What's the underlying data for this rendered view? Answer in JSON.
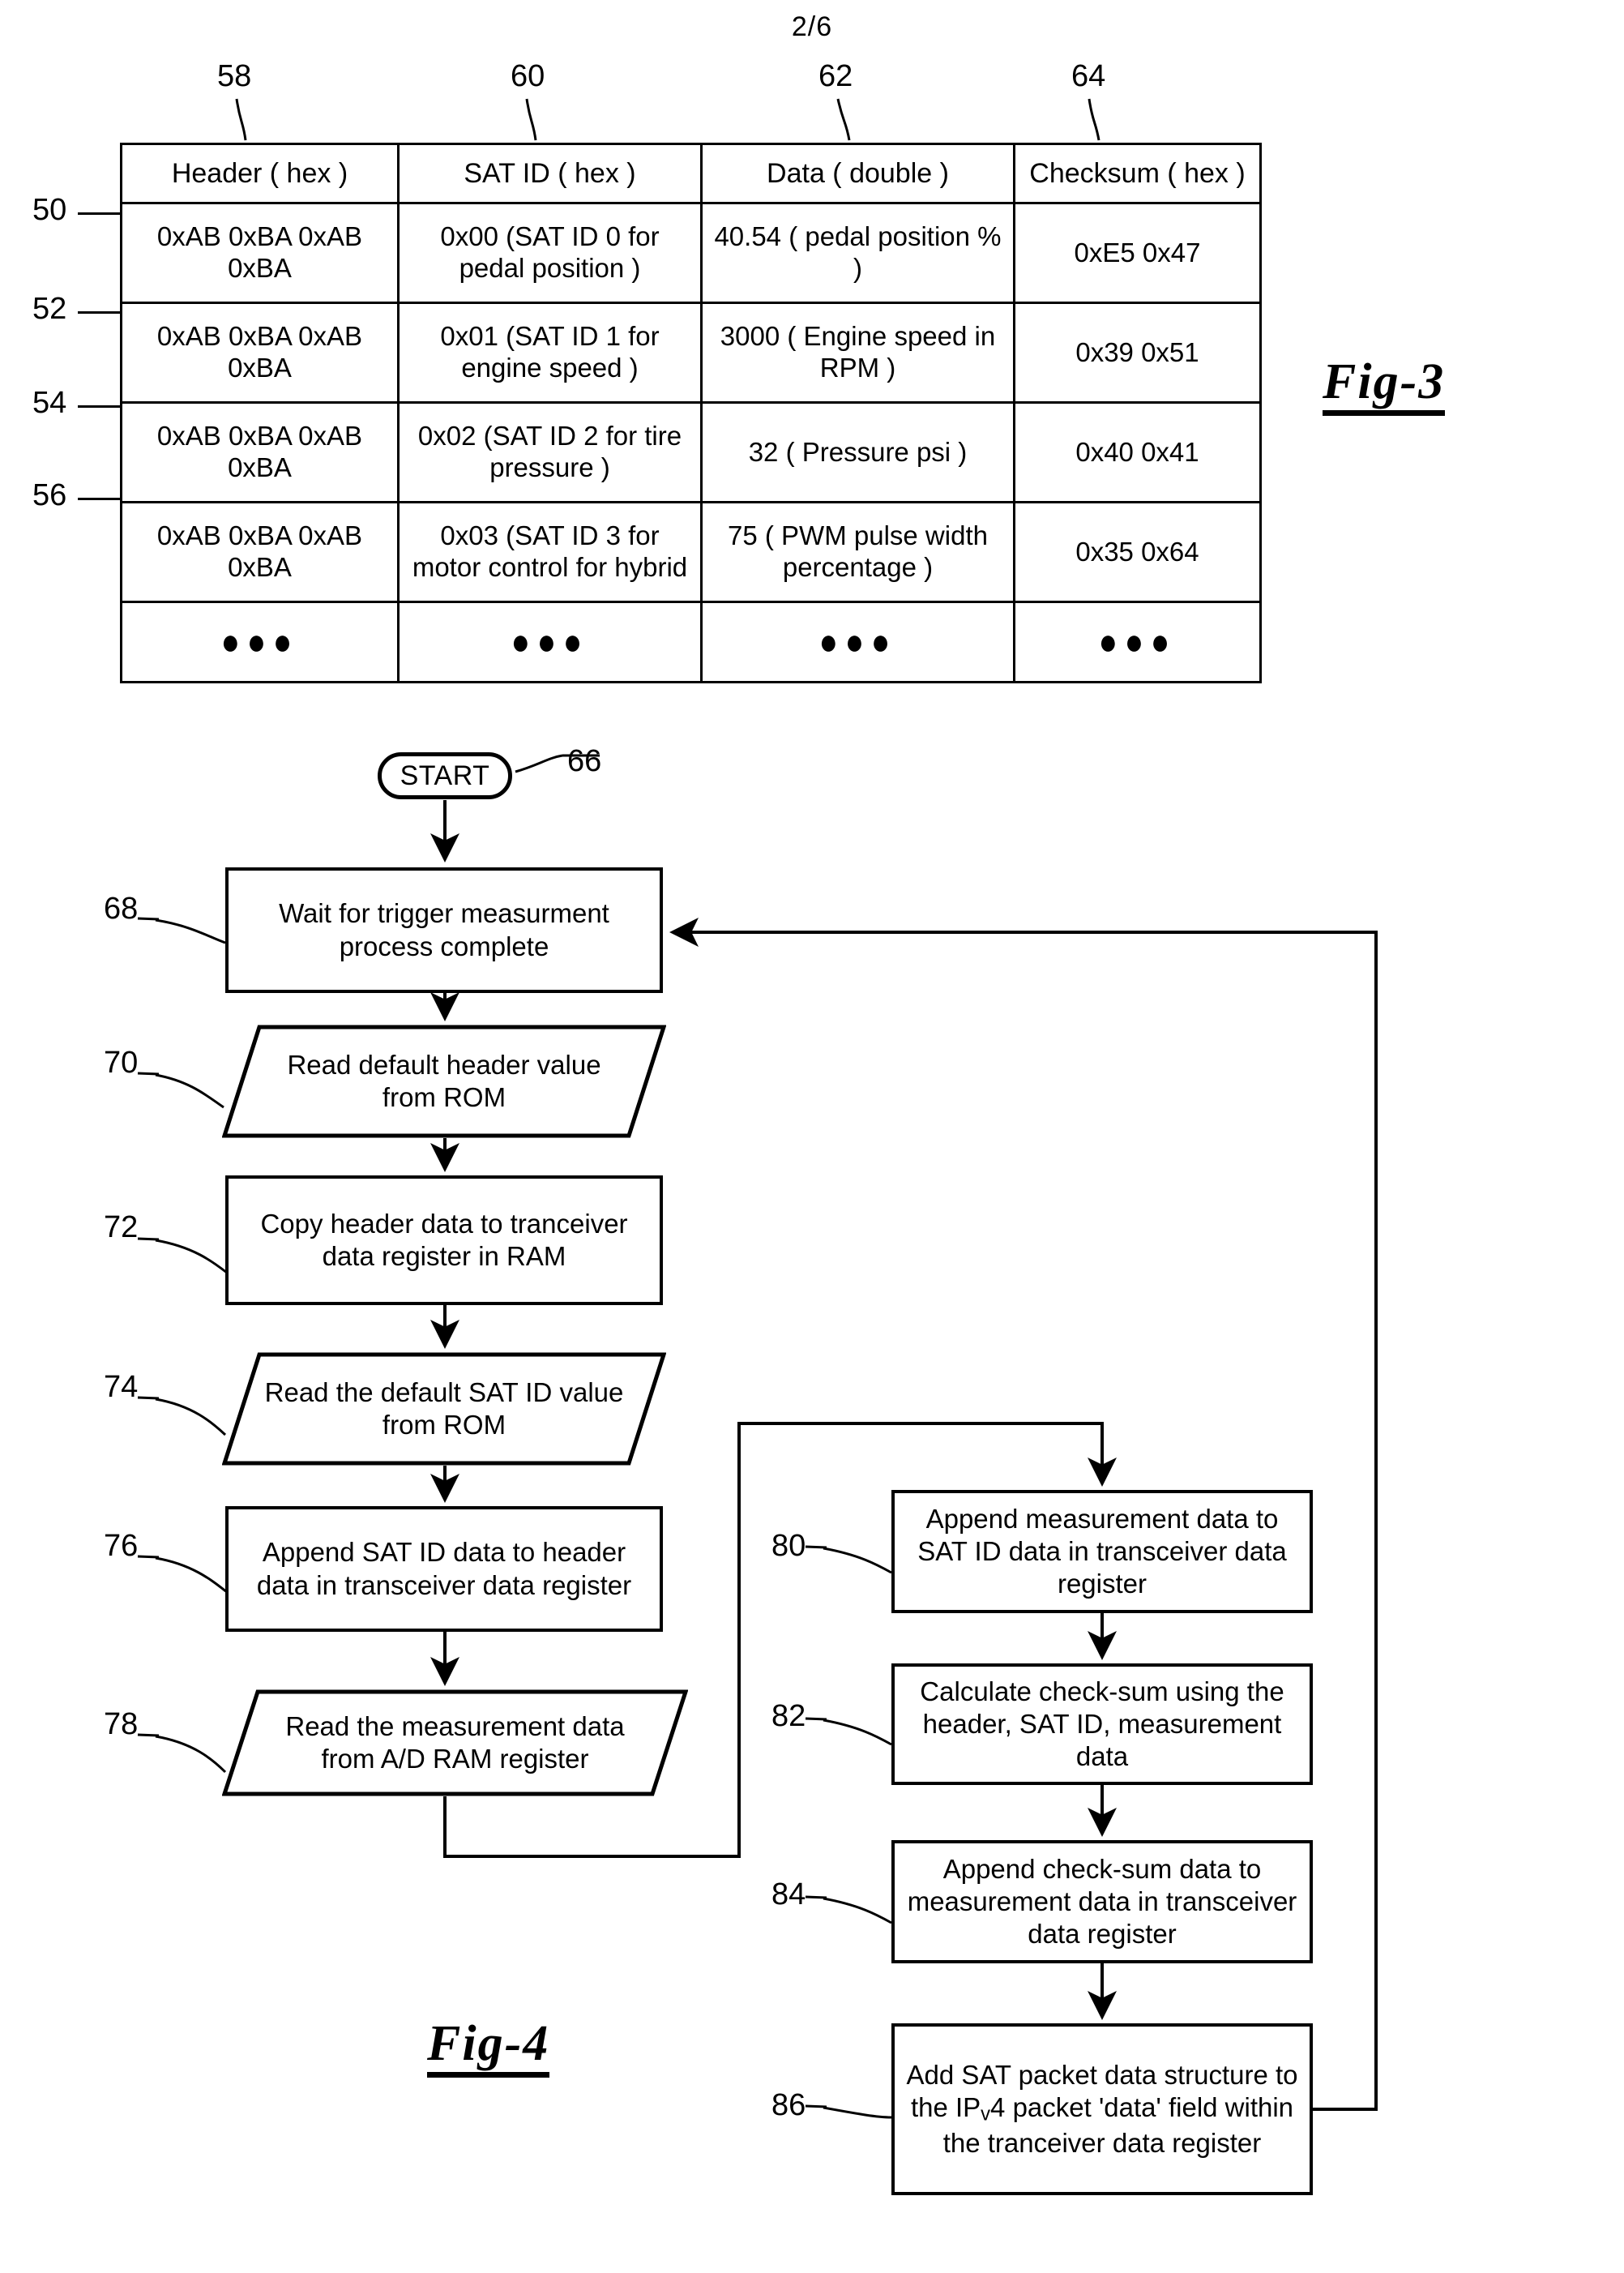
{
  "page": {
    "sheet_marker": "2/6"
  },
  "fig3": {
    "caption": "Fig-3",
    "column_callouts": [
      "58",
      "60",
      "62",
      "64"
    ],
    "row_callouts": [
      "50",
      "52",
      "54",
      "56"
    ],
    "headers": [
      "Header ( hex )",
      "SAT ID ( hex )",
      "Data ( double )",
      "Checksum ( hex )"
    ],
    "rows": [
      {
        "ref": "50",
        "header": "0xAB 0xBA 0xAB 0xBA",
        "sat_id": "0x00 (SAT ID 0 for pedal position )",
        "data": "40.54 ( pedal position % )",
        "checksum": "0xE5 0x47"
      },
      {
        "ref": "52",
        "header": "0xAB 0xBA 0xAB 0xBA",
        "sat_id": "0x01 (SAT ID 1 for engine speed )",
        "data": "3000 ( Engine speed in RPM )",
        "checksum": "0x39 0x51"
      },
      {
        "ref": "54",
        "header": "0xAB 0xBA 0xAB 0xBA",
        "sat_id": "0x02 (SAT ID 2 for tire pressure )",
        "data": "32 ( Pressure psi )",
        "checksum": "0x40 0x41"
      },
      {
        "ref": "56",
        "header": "0xAB 0xBA 0xAB 0xBA",
        "sat_id": "0x03 (SAT ID 3 for motor control for hybrid",
        "data": "75 ( PWM pulse width percentage )",
        "checksum": "0x35 0x64"
      }
    ],
    "continuation_dots": "●●●"
  },
  "fig4": {
    "caption": "Fig-4",
    "nodes": {
      "start": {
        "ref": "66",
        "label": "START",
        "shape": "terminator"
      },
      "n68": {
        "ref": "68",
        "label": "Wait for trigger measurment process complete",
        "shape": "process"
      },
      "n70": {
        "ref": "70",
        "label": "Read default header value from ROM",
        "shape": "io"
      },
      "n72": {
        "ref": "72",
        "label": "Copy header data to tranceiver data register  in RAM",
        "shape": "process"
      },
      "n74": {
        "ref": "74",
        "label": "Read the default SAT ID value from ROM",
        "shape": "io"
      },
      "n76": {
        "ref": "76",
        "label": "Append SAT ID data to header data in transceiver data register",
        "shape": "process"
      },
      "n78": {
        "ref": "78",
        "label": "Read the measurement data from A/D RAM register",
        "shape": "io"
      },
      "n80": {
        "ref": "80",
        "label": "Append measurement data to SAT ID data in transceiver data register",
        "shape": "process"
      },
      "n82": {
        "ref": "82",
        "label": "Calculate check-sum using the header, SAT ID, measurement data",
        "shape": "process"
      },
      "n84": {
        "ref": "84",
        "label": "Append check-sum data to measurement data in transceiver data register",
        "shape": "process"
      },
      "n86": {
        "ref": "86",
        "label_pre": "Add SAT packet data structure to the IP",
        "label_sub": "v",
        "label_post": "4 packet 'data' field within the tranceiver data register",
        "shape": "process"
      }
    }
  }
}
